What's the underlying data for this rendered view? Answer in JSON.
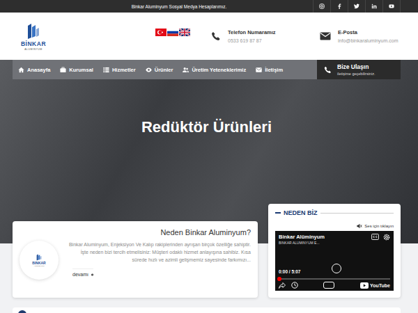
{
  "top_bar": {
    "text": "Binkar Aluminyum Sosyal Medya Hesaplarımız."
  },
  "header": {
    "logo": {
      "name": "BİNKAR",
      "sub": "ALUMINYUM"
    },
    "phone": {
      "label": "Telefon Numaramız",
      "value": "0533 619 87 87"
    },
    "email": {
      "label": "E-Posta",
      "value": "info@binkaraluminyum.com"
    }
  },
  "nav": {
    "items": [
      {
        "label": "Anasayfa",
        "selected": false
      },
      {
        "label": "Kurumsal",
        "selected": false
      },
      {
        "label": "Hizmetler",
        "selected": false
      },
      {
        "label": "Ürünler",
        "selected": false
      },
      {
        "label": "Üretim Yeteneklerimiz",
        "selected": false
      },
      {
        "label": "İletişim",
        "selected": false
      }
    ],
    "contact_button": {
      "title": "Bize Ulaşın",
      "subtitle": "iletişime geçebilirsiniz."
    }
  },
  "hero": {
    "title": "Redüktör Ürünleri"
  },
  "about_card": {
    "title": "Neden Binkar Aluminyum?",
    "logo": {
      "name": "BINKAR",
      "sub": "ALUMINYUM"
    },
    "text": "Binkar Aluminyum, Enjeksiyon Ve Kalıp rakiplerinden ayrışan birçok özelliğe sahiptir. İşte neden bizi tercih etmelisiniz: Müşteri odaklı hizmet anlayışına sahibiz. Kısa sürede hızlı ve azimli gelişmemiz sayesinde farkımızı...",
    "link": "devamı"
  },
  "why_card": {
    "title": "NEDEN BİZ",
    "sound_hint": "Ses için tıklayın",
    "video": {
      "title": "Binkar Alüminyum",
      "channel": "BINKAR ALUMINYUM E...",
      "time": "0:00 / 5:07",
      "brand": "YouTube",
      "level": 0
    }
  }
}
